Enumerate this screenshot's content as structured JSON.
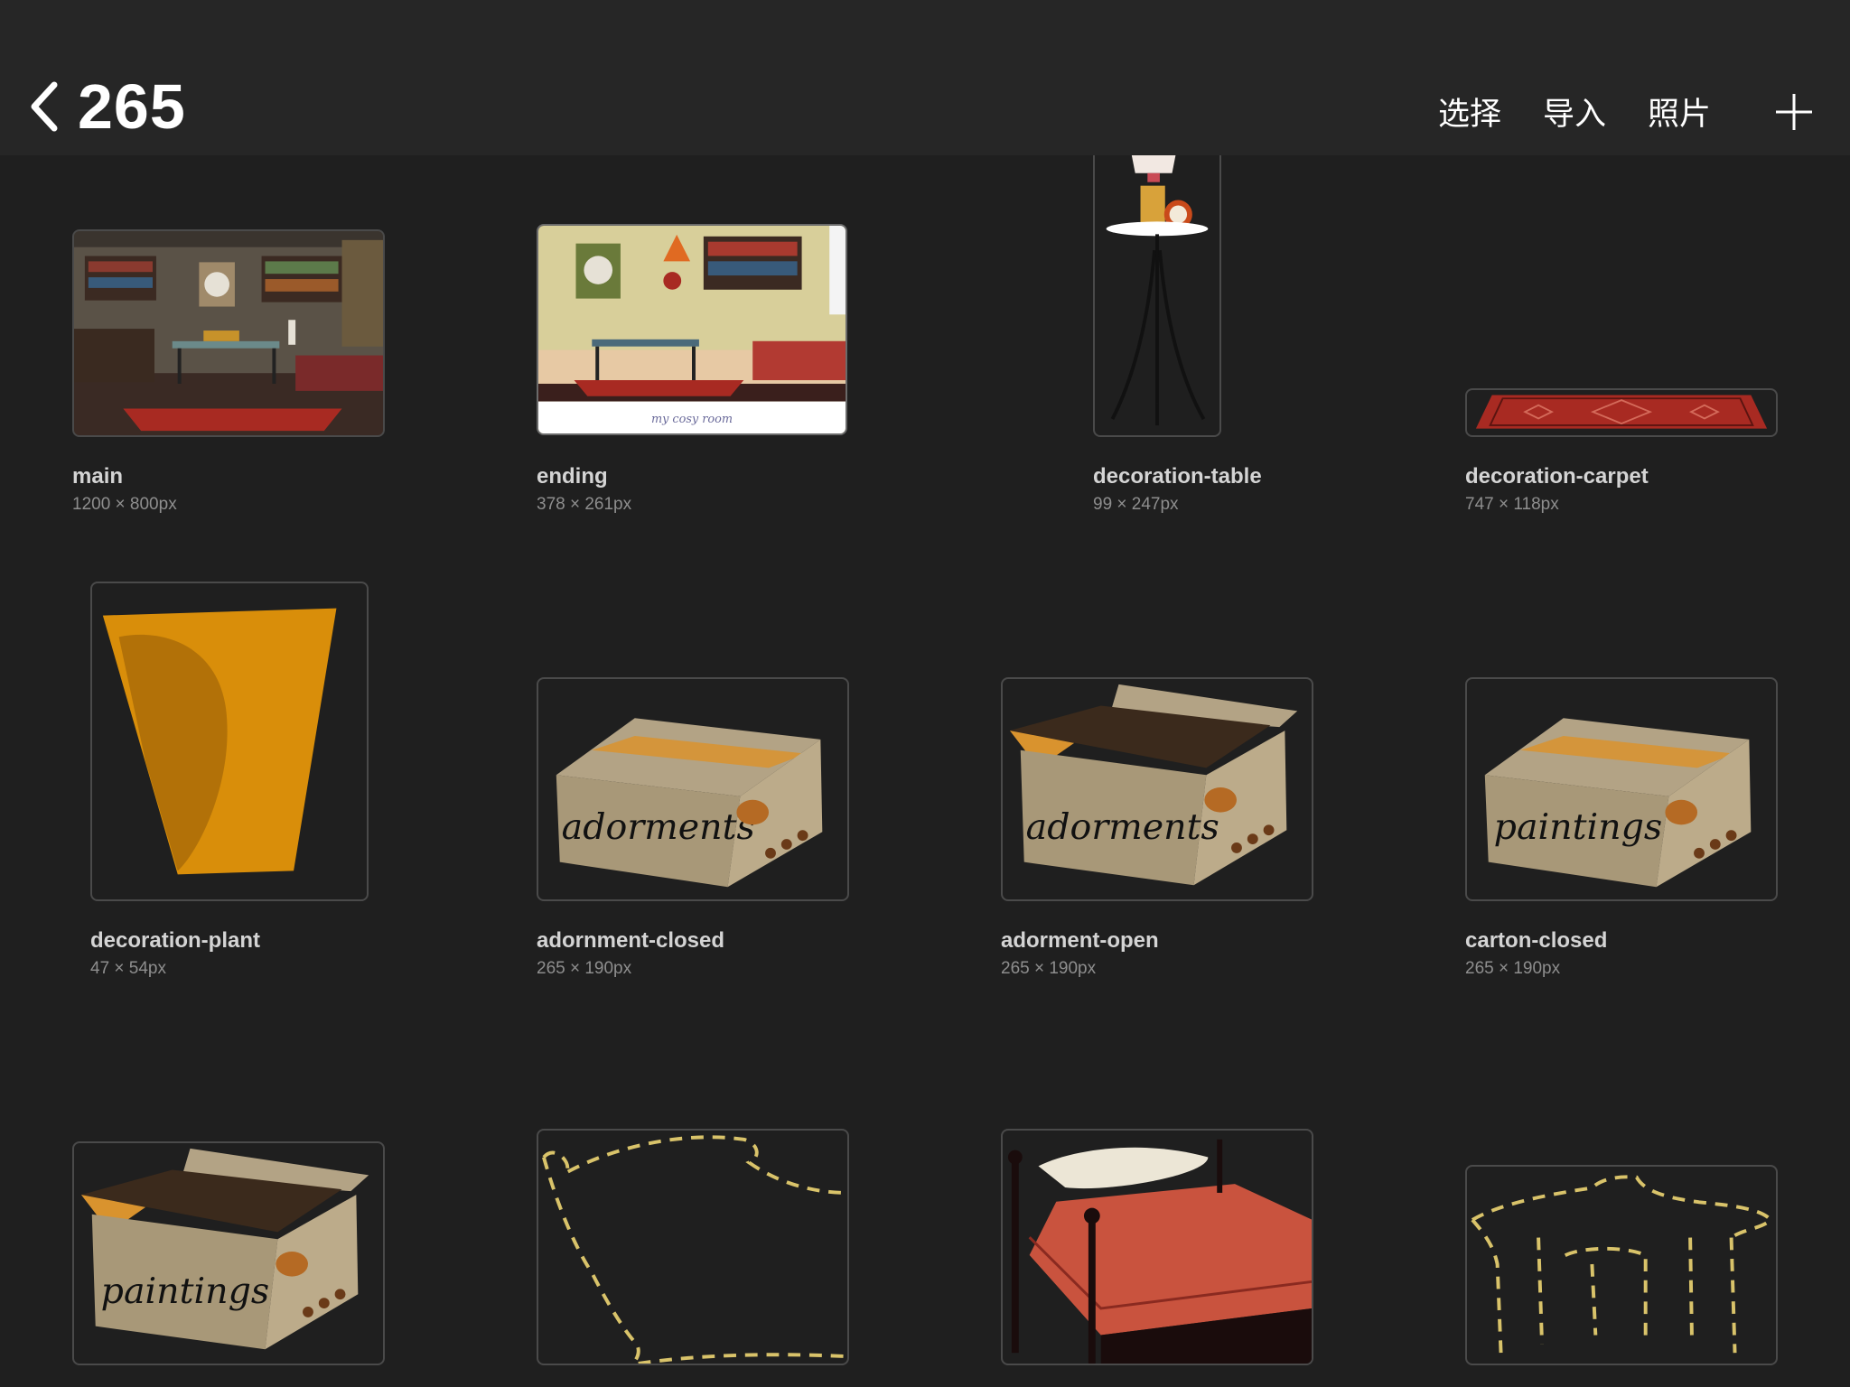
{
  "header": {
    "title": "265",
    "actions": {
      "select": "选择",
      "import": "导入",
      "photos": "照片"
    }
  },
  "assets": [
    {
      "name": "main",
      "dims": "1200 × 800px"
    },
    {
      "name": "ending",
      "dims": "378 × 261px",
      "caption": "my cosy room"
    },
    {
      "name": "decoration-table",
      "dims": "99 × 247px"
    },
    {
      "name": "decoration-carpet",
      "dims": "747 × 118px"
    },
    {
      "name": "decoration-plant",
      "dims": "47 × 54px"
    },
    {
      "name": "adornment-closed",
      "dims": "265 × 190px",
      "box_text": "adorments"
    },
    {
      "name": "adorment-open",
      "dims": "265 × 190px",
      "box_text": "adorments"
    },
    {
      "name": "carton-closed",
      "dims": "265 × 190px",
      "box_text": "paintings"
    },
    {
      "name": "",
      "dims": "",
      "box_text": "paintings"
    },
    {
      "name": "",
      "dims": ""
    },
    {
      "name": "",
      "dims": ""
    },
    {
      "name": "",
      "dims": ""
    }
  ],
  "colors": {
    "background": "#1f1f1f",
    "header": "#262626",
    "label": "#d4d4d4",
    "dims": "#8e8e8e",
    "border": "#4a4a4a"
  }
}
